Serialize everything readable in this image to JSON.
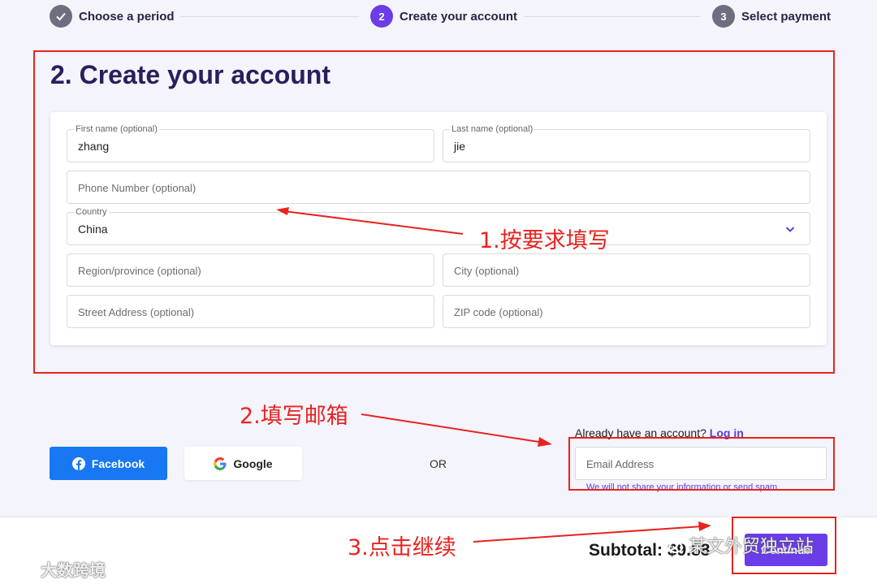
{
  "stepper": {
    "steps": [
      {
        "number": "✓",
        "label": "Choose a period"
      },
      {
        "number": "2",
        "label": "Create your account"
      },
      {
        "number": "3",
        "label": "Select payment"
      }
    ]
  },
  "form": {
    "title": "2. Create your account",
    "first_name": {
      "label": "First name (optional)",
      "value": "zhang"
    },
    "last_name": {
      "label": "Last name (optional)",
      "value": "jie"
    },
    "phone": {
      "placeholder": "Phone Number (optional)"
    },
    "country": {
      "label": "Country",
      "value": "China"
    },
    "region": {
      "placeholder": "Region/province (optional)"
    },
    "city": {
      "placeholder": "City (optional)"
    },
    "street": {
      "placeholder": "Street Address (optional)"
    },
    "zip": {
      "placeholder": "ZIP code (optional)"
    }
  },
  "annotations": {
    "step1": "1.按要求填写",
    "step2": "2.填写邮箱",
    "step3": "3.点击继续",
    "color": "#e8231f"
  },
  "social": {
    "facebook_label": "Facebook",
    "google_label": "Google",
    "or_label": "OR"
  },
  "email_section": {
    "already_text": "Already have an account?",
    "login_link": "Log in",
    "email_placeholder": "Email Address",
    "no_spam": "We will not share your information or send spam."
  },
  "footer": {
    "subtotal": "Subtotal: $9.88",
    "continue_label": "Continue"
  },
  "watermarks": {
    "left": "大数跨境",
    "right": "某文外贸独立站"
  },
  "colors": {
    "accent": "#6a3de8",
    "title": "#2a1f5c",
    "facebook": "#1877f2"
  }
}
